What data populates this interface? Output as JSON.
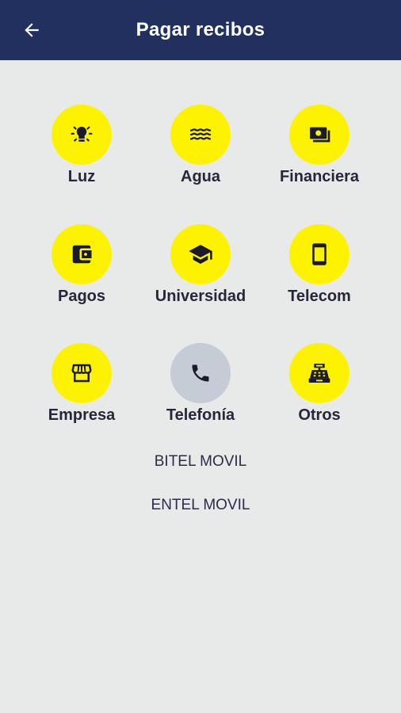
{
  "header": {
    "title": "Pagar recibos"
  },
  "categories": [
    {
      "label": "Luz",
      "icon": "light-bulb-icon"
    },
    {
      "label": "Agua",
      "icon": "water-waves-icon"
    },
    {
      "label": "Financiera",
      "icon": "money-icon"
    },
    {
      "label": "Pagos",
      "icon": "wallet-icon"
    },
    {
      "label": "Universidad",
      "icon": "graduation-cap-icon"
    },
    {
      "label": "Telecom",
      "icon": "smartphone-icon"
    },
    {
      "label": "Empresa",
      "icon": "store-icon"
    },
    {
      "label": "Telefonía",
      "icon": "phone-icon",
      "selected": true
    },
    {
      "label": "Otros",
      "icon": "cash-register-icon"
    }
  ],
  "telefonia_options": [
    "BITEL MOVIL",
    "ENTEL MOVIL"
  ],
  "colors": {
    "appbar": "#22305f",
    "accent": "#fdf300",
    "selected": "#c5ccd6",
    "background": "#e8e9e9"
  }
}
